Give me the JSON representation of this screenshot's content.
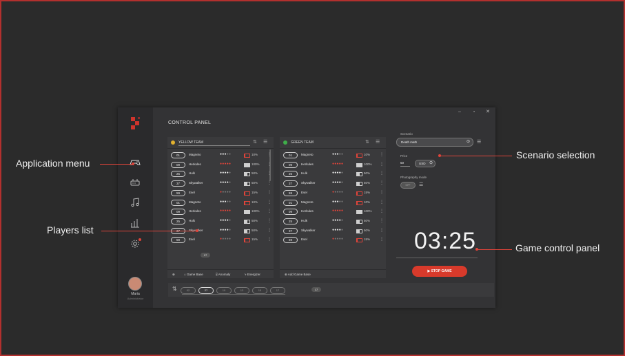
{
  "window": {
    "title": "CONTROL PANEL"
  },
  "sidebar": {
    "items": [
      {
        "icon": "gamepad-icon"
      },
      {
        "icon": "router-icon"
      },
      {
        "icon": "music-icon"
      },
      {
        "icon": "bar-chart-icon"
      },
      {
        "icon": "gear-icon"
      }
    ],
    "user": {
      "name": "Maria",
      "role": "Administrator"
    }
  },
  "yellow_team": {
    "name": "YELLOW TEAM",
    "color": "#e2b12f",
    "players": [
      {
        "num": "01",
        "name": "Magneto",
        "stars": 3,
        "battery": "10%",
        "low": true
      },
      {
        "num": "09",
        "name": "Herkules",
        "stars": 5,
        "battery": "100%",
        "low": false
      },
      {
        "num": "25",
        "name": "Hulk",
        "stars": 4,
        "battery": "50%",
        "low": false
      },
      {
        "num": "37",
        "name": "Skywalker",
        "stars": 4,
        "battery": "50%",
        "low": false
      },
      {
        "num": "59",
        "name": "Esel",
        "stars": 1,
        "battery": "15%",
        "low": true
      },
      {
        "num": "01",
        "name": "Magneto",
        "stars": 3,
        "battery": "10%",
        "low": true
      },
      {
        "num": "09",
        "name": "Herkules",
        "stars": 5,
        "battery": "100%",
        "low": false
      },
      {
        "num": "25",
        "name": "Hulk",
        "stars": 4,
        "battery": "50%",
        "low": false
      },
      {
        "num": "37",
        "name": "Skywalker",
        "stars": 4,
        "battery": "50%",
        "low": false
      },
      {
        "num": "59",
        "name": "Esel",
        "stars": 1,
        "battery": "15%",
        "low": true
      }
    ],
    "pager": "17",
    "footer": {
      "game_base": "Game Base",
      "anomaly": "Anomaly",
      "energizer": "Energizer"
    }
  },
  "green_team": {
    "name": "GREEN TEAM",
    "color": "#3fae4a",
    "players": [
      {
        "num": "01",
        "name": "Magneto",
        "stars": 3,
        "battery": "10%",
        "low": true
      },
      {
        "num": "09",
        "name": "Herkules",
        "stars": 5,
        "battery": "100%",
        "low": false
      },
      {
        "num": "25",
        "name": "Hulk",
        "stars": 4,
        "battery": "50%",
        "low": false
      },
      {
        "num": "37",
        "name": "Skywalker",
        "stars": 4,
        "battery": "50%",
        "low": false
      },
      {
        "num": "59",
        "name": "Esel",
        "stars": 1,
        "battery": "15%",
        "low": true
      },
      {
        "num": "01",
        "name": "Magneto",
        "stars": 3,
        "battery": "10%",
        "low": true
      },
      {
        "num": "09",
        "name": "Herkules",
        "stars": 5,
        "battery": "100%",
        "low": false
      },
      {
        "num": "25",
        "name": "Hulk",
        "stars": 4,
        "battery": "50%",
        "low": false
      },
      {
        "num": "37",
        "name": "Skywalker",
        "stars": 4,
        "battery": "50%",
        "low": false
      },
      {
        "num": "59",
        "name": "Esel",
        "stars": 1,
        "battery": "15%",
        "low": true
      }
    ],
    "footer": {
      "add_game_base": "Add Game Base"
    }
  },
  "right_panel": {
    "scenario_label": "Scenario",
    "scenario_value": "Death math",
    "price_label": "Price",
    "price_value": "50",
    "currency": "USD",
    "photo_label": "Photography mode",
    "photo_toggle": "OFF",
    "timer": "03:25",
    "stop_label": "STOP GAME"
  },
  "bottom_bar": {
    "pills": [
      "02",
      "27",
      "10",
      "13",
      "15",
      "17"
    ],
    "active_index": 1,
    "pager": "17"
  },
  "annotations": {
    "application_menu": "Application menu",
    "players_list": "Players list",
    "scenario_selection": "Scenario selection",
    "game_control_panel": "Game control panel"
  },
  "colors": {
    "accent": "#d83a2b",
    "star_on": "#e0443a"
  }
}
